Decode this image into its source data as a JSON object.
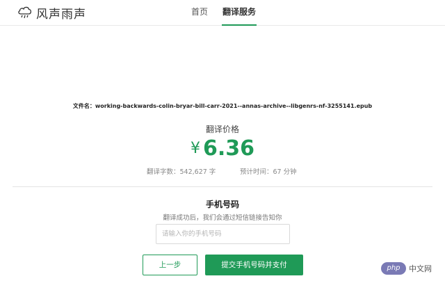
{
  "header": {
    "logo_icon": "cloud-rain-icon",
    "brand": "风声雨声",
    "nav": [
      {
        "label": "首页",
        "active": false
      },
      {
        "label": "翻译服务",
        "active": true
      }
    ],
    "accent_color": "#1f9a57"
  },
  "file": {
    "label": "文件名：",
    "name": "working-backwards-colin-bryar-bill-carr-2021--annas-archive--libgenrs-nf-3255141.epub"
  },
  "price": {
    "label": "翻译价格",
    "currency": "¥",
    "amount": "6.36"
  },
  "stats": {
    "words": "翻译字数：542,627 字",
    "time": "预计时间：67 分钟"
  },
  "phone": {
    "label": "手机号码",
    "hint": "翻译成功后，我们会通过短信链接告知你",
    "placeholder": "请输入你的手机号码",
    "value": ""
  },
  "buttons": {
    "back": "上一步",
    "submit": "提交手机号码并支付"
  },
  "watermark": {
    "badge": "php",
    "text": "中文网"
  }
}
